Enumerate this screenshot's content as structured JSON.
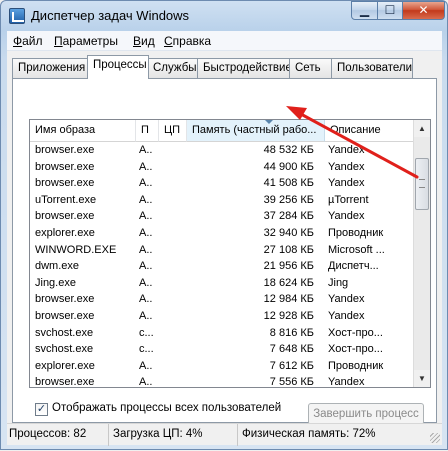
{
  "window": {
    "title": "Диспетчер задач Windows"
  },
  "menu": [
    {
      "u": "Ф",
      "rest": "айл"
    },
    {
      "u": "П",
      "rest": "араметры"
    },
    {
      "u": "В",
      "rest": "ид"
    },
    {
      "u": "С",
      "rest": "правка"
    }
  ],
  "tabs": [
    "Приложения",
    "Процессы",
    "Службы",
    "Быстродействие",
    "Сеть",
    "Пользователи"
  ],
  "active_tab": "Процессы",
  "columns": {
    "name": "Имя образа",
    "user": "П",
    "cpu": "ЦП",
    "memory": "Память (частный рабо...",
    "description": "Описание"
  },
  "rows": [
    {
      "name": "browser.exe",
      "user": "A...",
      "cpu": "",
      "memory": "48 532 КБ",
      "description": "Yandex"
    },
    {
      "name": "browser.exe",
      "user": "A...",
      "cpu": "",
      "memory": "44 900 КБ",
      "description": "Yandex"
    },
    {
      "name": "browser.exe",
      "user": "A...",
      "cpu": "",
      "memory": "41 508 КБ",
      "description": "Yandex"
    },
    {
      "name": "uTorrent.exe",
      "user": "A...",
      "cpu": "",
      "memory": "39 256 КБ",
      "description": "µTorrent"
    },
    {
      "name": "browser.exe",
      "user": "A...",
      "cpu": "",
      "memory": "37 284 КБ",
      "description": "Yandex"
    },
    {
      "name": "explorer.exe",
      "user": "A...",
      "cpu": "",
      "memory": "32 940 КБ",
      "description": "Проводник"
    },
    {
      "name": "WINWORD.EXE",
      "user": "A...",
      "cpu": "",
      "memory": "27 108 КБ",
      "description": "Microsoft ..."
    },
    {
      "name": "dwm.exe",
      "user": "A...",
      "cpu": "",
      "memory": "21 956 КБ",
      "description": "Диспетч..."
    },
    {
      "name": "Jing.exe",
      "user": "A...",
      "cpu": "",
      "memory": "18 624 КБ",
      "description": "Jing"
    },
    {
      "name": "browser.exe",
      "user": "A...",
      "cpu": "",
      "memory": "12 984 КБ",
      "description": "Yandex"
    },
    {
      "name": "browser.exe",
      "user": "A...",
      "cpu": "",
      "memory": "12 928 КБ",
      "description": "Yandex"
    },
    {
      "name": "svchost.exe",
      "user": "c...",
      "cpu": "",
      "memory": "8 816 КБ",
      "description": "Хост-про..."
    },
    {
      "name": "svchost.exe",
      "user": "c...",
      "cpu": "",
      "memory": "7 648 КБ",
      "description": "Хост-про..."
    },
    {
      "name": "explorer.exe",
      "user": "A...",
      "cpu": "",
      "memory": "7 612 КБ",
      "description": "Проводник"
    },
    {
      "name": "browser.exe",
      "user": "A...",
      "cpu": "",
      "memory": "7 556 КБ",
      "description": "Yandex"
    }
  ],
  "show_all_users": {
    "label": "Отображать процессы всех пользователей",
    "checked": true
  },
  "end_process_button": "Завершить процесс",
  "status": {
    "processes": "Процессов: 82",
    "cpu": "Загрузка ЦП: 4%",
    "memory": "Физическая память: 72%"
  },
  "colors": {
    "annotation_arrow": "#e0201b",
    "sorted_column": "#e3f2fb"
  }
}
